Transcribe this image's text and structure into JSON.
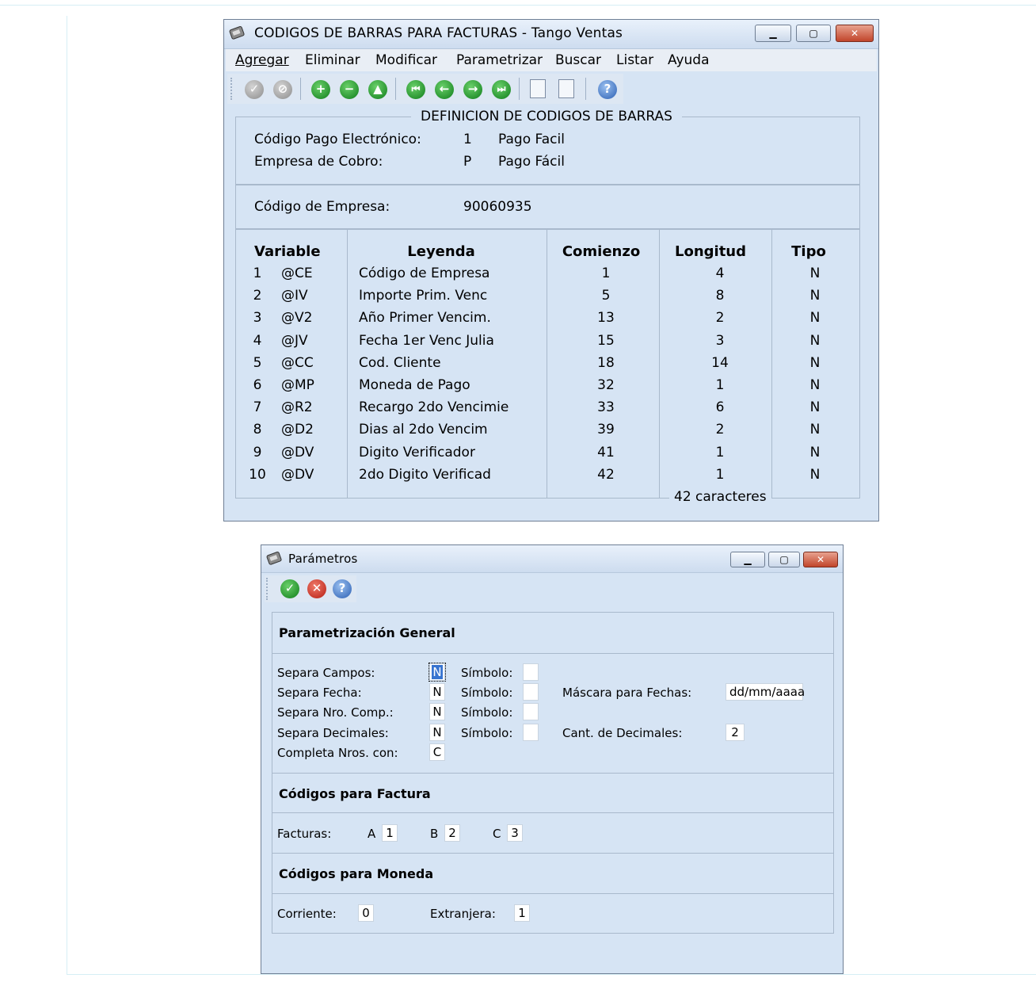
{
  "window1": {
    "title": "CODIGOS DE BARRAS PARA FACTURAS - Tango Ventas",
    "menu": [
      "Agregar",
      "Eliminar",
      "Modificar",
      "Parametrizar",
      "Buscar",
      "Listar",
      "Ayuda"
    ],
    "section_title": "DEFINICION DE CODIGOS DE BARRAS",
    "codigo_pago_label": "Código Pago Electrónico:",
    "codigo_pago_value": "1",
    "codigo_pago_desc": "Pago Facil",
    "empresa_cobro_label": "Empresa de Cobro:",
    "empresa_cobro_value": "P",
    "empresa_cobro_desc": "Pago Fácil",
    "codigo_empresa_label": "Código de Empresa:",
    "codigo_empresa_value": "90060935",
    "table": {
      "headers": [
        "Variable",
        "Leyenda",
        "Comienzo",
        "Longitud",
        "Tipo"
      ],
      "rows": [
        {
          "n": "1",
          "var": "@CE",
          "leyenda": "Código de Empresa",
          "comienzo": "1",
          "longitud": "4",
          "tipo": "N"
        },
        {
          "n": "2",
          "var": "@IV",
          "leyenda": "Importe Prim. Venc",
          "comienzo": "5",
          "longitud": "8",
          "tipo": "N"
        },
        {
          "n": "3",
          "var": "@V2",
          "leyenda": "Año Primer Vencim.",
          "comienzo": "13",
          "longitud": "2",
          "tipo": "N"
        },
        {
          "n": "4",
          "var": "@JV",
          "leyenda": "Fecha 1er Venc Julia",
          "comienzo": "15",
          "longitud": "3",
          "tipo": "N"
        },
        {
          "n": "5",
          "var": "@CC",
          "leyenda": "Cod. Cliente",
          "comienzo": "18",
          "longitud": "14",
          "tipo": "N"
        },
        {
          "n": "6",
          "var": "@MP",
          "leyenda": "Moneda de Pago",
          "comienzo": "32",
          "longitud": "1",
          "tipo": "N"
        },
        {
          "n": "7",
          "var": "@R2",
          "leyenda": "Recargo 2do Vencimie",
          "comienzo": "33",
          "longitud": "6",
          "tipo": "N"
        },
        {
          "n": "8",
          "var": "@D2",
          "leyenda": "Dias al 2do Vencim",
          "comienzo": "39",
          "longitud": "2",
          "tipo": "N"
        },
        {
          "n": "9",
          "var": "@DV",
          "leyenda": "Digito Verificador",
          "comienzo": "41",
          "longitud": "1",
          "tipo": "N"
        },
        {
          "n": "10",
          "var": "@DV",
          "leyenda": "2do Digito Verificad",
          "comienzo": "42",
          "longitud": "1",
          "tipo": "N"
        }
      ],
      "total": "42 caracteres"
    }
  },
  "window2": {
    "title": "Parámetros",
    "sec_general": "Parametrización General",
    "separa_campos_label": "Separa Campos:",
    "separa_campos_value": "N",
    "separa_fecha_label": "Separa Fecha:",
    "separa_fecha_value": "N",
    "separa_nro_label": "Separa Nro. Comp.:",
    "separa_nro_value": "N",
    "separa_dec_label": "Separa Decimales:",
    "separa_dec_value": "N",
    "completa_label": "Completa Nros. con:",
    "completa_value": "C",
    "simbolo_label": "Símbolo:",
    "mascara_label": "Máscara para Fechas:",
    "mascara_value": "dd/mm/aaaa",
    "cant_dec_label": "Cant. de Decimales:",
    "cant_dec_value": "2",
    "sec_factura": "Códigos para Factura",
    "facturas_label": "Facturas:",
    "fact_a_label": "A",
    "fact_a_value": "1",
    "fact_b_label": "B",
    "fact_b_value": "2",
    "fact_c_label": "C",
    "fact_c_value": "3",
    "sec_moneda": "Códigos para Moneda",
    "corriente_label": "Corriente:",
    "corriente_value": "0",
    "extranjera_label": "Extranjera:",
    "extranjera_value": "1"
  }
}
